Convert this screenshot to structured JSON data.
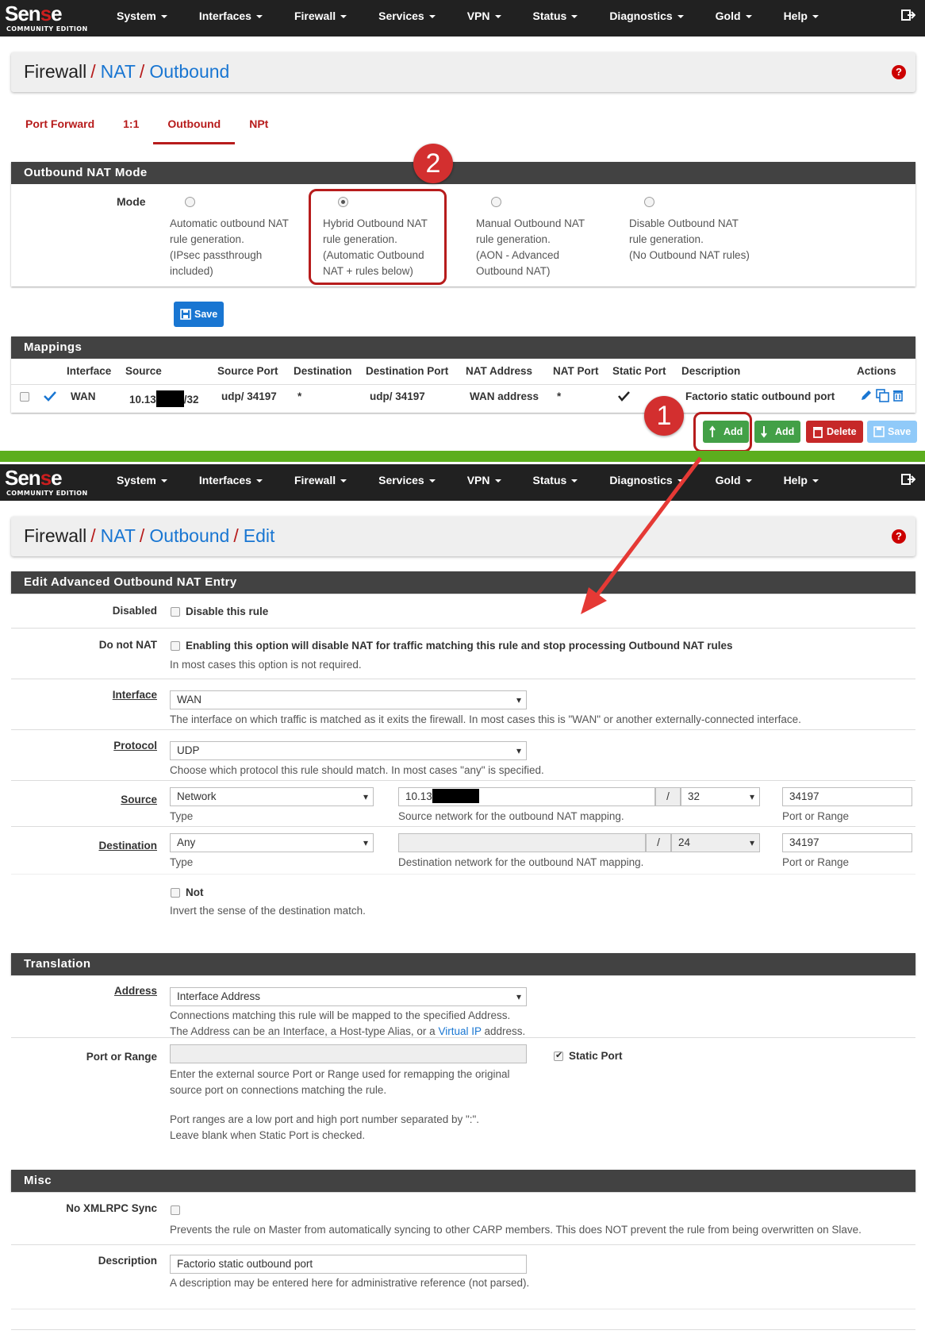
{
  "brand": {
    "logo_main": "Sen",
    "logo_red": "s",
    "logo_end": "e",
    "logo_sub": "COMMUNITY EDITION"
  },
  "nav": [
    "System",
    "Interfaces",
    "Firewall",
    "Services",
    "VPN",
    "Status",
    "Diagnostics",
    "Gold",
    "Help"
  ],
  "top": {
    "breadcrumb": {
      "first": "Firewall",
      "sep": "/",
      "second": "NAT",
      "third": "Outbound"
    },
    "tabs": [
      "Port Forward",
      "1:1",
      "Outbound",
      "NPt"
    ],
    "mode_panel": {
      "title": "Outbound NAT Mode",
      "mode_label": "Mode",
      "options": [
        {
          "lines": [
            "Automatic outbound NAT",
            "rule generation.",
            "(IPsec passthrough",
            "included)"
          ],
          "checked": false
        },
        {
          "lines": [
            "Hybrid Outbound NAT",
            "rule generation.",
            "(Automatic Outbound",
            "NAT + rules below)"
          ],
          "checked": true
        },
        {
          "lines": [
            "Manual Outbound NAT",
            "rule generation.",
            "(AON - Advanced",
            "Outbound NAT)"
          ],
          "checked": false
        },
        {
          "lines": [
            "Disable Outbound NAT",
            "rule generation.",
            "(No Outbound NAT rules)"
          ],
          "checked": false
        }
      ],
      "save_label": "Save"
    },
    "mappings": {
      "title": "Mappings",
      "columns": [
        "Interface",
        "Source",
        "Source Port",
        "Destination",
        "Destination Port",
        "NAT Address",
        "NAT Port",
        "Static Port",
        "Description",
        "Actions"
      ],
      "row": {
        "interface": "WAN",
        "source_pre": "10.13",
        "source_post": "/32",
        "source_port": "udp/ 34197",
        "destination": "*",
        "destination_port": "udp/ 34197",
        "nat_address": "WAN address",
        "nat_port": "*",
        "description": "Factorio static outbound port"
      },
      "buttons": {
        "add_top": "Add",
        "add_bottom": "Add",
        "delete": "Delete",
        "save": "Save"
      }
    },
    "annotations": {
      "one": "1",
      "two": "2"
    }
  },
  "edit": {
    "breadcrumb": {
      "first": "Firewall",
      "sep": "/",
      "second": "NAT",
      "third": "Outbound",
      "fourth": "Edit"
    },
    "panel_title": "Edit Advanced Outbound NAT Entry",
    "disabled": {
      "label": "Disabled",
      "text": "Disable this rule"
    },
    "do_not_nat": {
      "label": "Do not NAT",
      "text": "Enabling this option will disable NAT for traffic matching this rule and stop processing Outbound NAT rules",
      "help": "In most cases this option is not required."
    },
    "interface": {
      "label": "Interface",
      "value": "WAN",
      "help": "The interface on which traffic is matched as it exits the firewall. In most cases this is \"WAN\" or another externally-connected interface."
    },
    "protocol": {
      "label": "Protocol",
      "value": "UDP",
      "help": "Choose which protocol this rule should match. In most cases \"any\" is specified."
    },
    "source": {
      "label": "Source",
      "type": "Network",
      "type_help": "Type",
      "address": "10.13",
      "slash": "/",
      "mask": "32",
      "address_help": "Source network for the outbound NAT mapping.",
      "port": "34197",
      "port_help": "Port or Range"
    },
    "destination": {
      "label": "Destination",
      "type": "Any",
      "type_help": "Type",
      "address": "",
      "slash": "/",
      "mask": "24",
      "address_help": "Destination network for the outbound NAT mapping.",
      "port": "34197",
      "port_help": "Port or Range"
    },
    "not": {
      "text": "Not",
      "help": "Invert the sense of the destination match."
    },
    "translation": {
      "title": "Translation",
      "address_label": "Address",
      "address_value": "Interface Address",
      "address_help_1": "Connections matching this rule will be mapped to the specified Address.",
      "address_help_2_pre": "The Address can be an Interface, a Host-type Alias, or a",
      "address_help_2_link": "Virtual IP",
      "address_help_2_post": "address.",
      "port_label": "Port or Range",
      "static_port": "Static Port",
      "port_help_1": "Enter the external source Port or Range used for remapping the original",
      "port_help_2": "source port on connections matching the rule.",
      "port_help_3": "Port ranges are a low port and high port number separated by \":\".",
      "port_help_4": "Leave blank when Static Port is checked."
    },
    "misc": {
      "title": "Misc",
      "xmlrpc_label": "No XMLRPC Sync",
      "xmlrpc_help": "Prevents the rule on Master from automatically syncing to other CARP members. This does NOT prevent the rule from being overwritten on Slave.",
      "description_label": "Description",
      "description_value": "Factorio static outbound port",
      "description_help": "A description may be entered here for administrative reference (not parsed)."
    }
  },
  "colors": {
    "navbar": "#212121",
    "accent_red": "#b71c1c",
    "link_blue": "#1976d2",
    "divider_green": "#5cae1e",
    "panel_head": "#424242"
  }
}
